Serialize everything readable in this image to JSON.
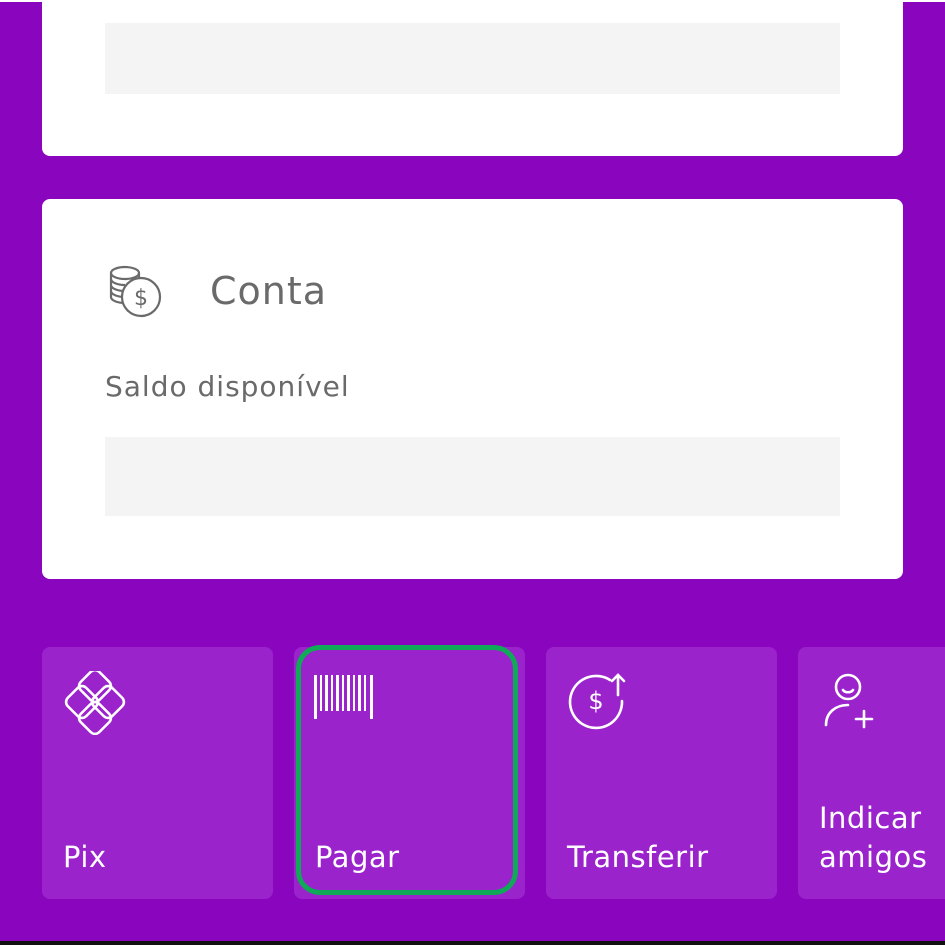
{
  "conta_card": {
    "title": "Conta",
    "balance_label": "Saldo disponível"
  },
  "shortcuts": [
    {
      "label": "Pix",
      "icon": "pix-icon"
    },
    {
      "label": "Pagar",
      "icon": "barcode-icon"
    },
    {
      "label": "Transferir",
      "icon": "transfer-money-icon"
    },
    {
      "label": "Indicar amigos",
      "label_line1": "Indicar",
      "label_line2": "amigos",
      "icon": "add-friend-icon"
    }
  ],
  "colors": {
    "brand": "#8a05be",
    "tile": "#9a23cc",
    "highlight": "#0fa958"
  }
}
